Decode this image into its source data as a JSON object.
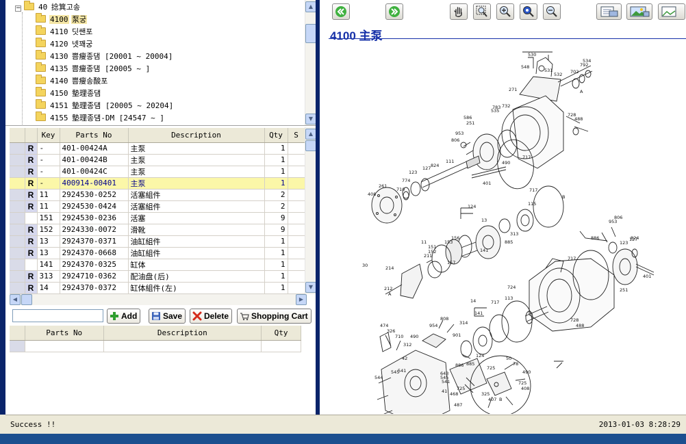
{
  "tree": {
    "root": {
      "code": "40",
      "label": "捻箕고송"
    },
    "items": [
      {
        "code": "4100",
        "label": "泵궁",
        "selected": true
      },
      {
        "code": "4110",
        "label": "딧쌘포"
      },
      {
        "code": "4120",
        "label": "넷꽤궁"
      },
      {
        "code": "4130",
        "label": "쁨瘦종댐  [20001 ~ 20004]"
      },
      {
        "code": "4135",
        "label": "쁨瘦종댐  [20005 ~ ]"
      },
      {
        "code": "4140",
        "label": "쁨瘦송酸포"
      },
      {
        "code": "4150",
        "label": "墊理종댐"
      },
      {
        "code": "4151",
        "label": "墊理종댐  [20005 ~ 20204]"
      },
      {
        "code": "4155",
        "label": "墊理종댐-DM  [24547  ~ ]"
      }
    ]
  },
  "parts_grid": {
    "columns": {
      "key": "Key",
      "parts_no": "Parts No",
      "description": "Description",
      "qty": "Qty",
      "s": "S"
    },
    "rows": [
      {
        "r": "R",
        "key": "-",
        "parts_no": "401-00424A",
        "description": "主泵",
        "qty": "1"
      },
      {
        "r": "R",
        "key": "-",
        "parts_no": "401-00424B",
        "description": "主泵",
        "qty": "1"
      },
      {
        "r": "R",
        "key": "-",
        "parts_no": "401-00424C",
        "description": "主泵",
        "qty": "1"
      },
      {
        "r": "R",
        "key": "-",
        "parts_no": "400914-00401",
        "description": "主泵",
        "qty": "1",
        "highlight": true
      },
      {
        "r": "R",
        "key": "11",
        "parts_no": "2924530-0252",
        "description": "活塞組件",
        "qty": "2"
      },
      {
        "r": "R",
        "key": "11",
        "parts_no": "2924530-0424",
        "description": "活塞組件",
        "qty": "2"
      },
      {
        "r": "",
        "key": "151",
        "parts_no": "2924530-0236",
        "description": "活塞",
        "qty": "9"
      },
      {
        "r": "R",
        "key": "152",
        "parts_no": "2924330-0072",
        "description": "滑靴",
        "qty": "9"
      },
      {
        "r": "R",
        "key": "13",
        "parts_no": "2924370-0371",
        "description": "油缸組件",
        "qty": "1"
      },
      {
        "r": "R",
        "key": "13",
        "parts_no": "2924370-0668",
        "description": "油缸組件",
        "qty": "1"
      },
      {
        "r": "",
        "key": "141",
        "parts_no": "2924370-0325",
        "description": "缸体",
        "qty": "1"
      },
      {
        "r": "R",
        "key": "313",
        "parts_no": "2924710-0362",
        "description": "配油盘(后)",
        "qty": "1"
      },
      {
        "r": "R",
        "key": "14",
        "parts_no": "2924370-0372",
        "description": "缸体組件(左)",
        "qty": "1"
      }
    ]
  },
  "actions": {
    "search_value": "",
    "add_label": "Add",
    "save_label": "Save",
    "delete_label": "Delete",
    "cart_label": "Shopping Cart"
  },
  "cart_grid": {
    "columns": {
      "parts_no": "Parts No",
      "description": "Description",
      "qty": "Qty"
    }
  },
  "diagram": {
    "title": "4100 主泵",
    "callouts": [
      "530",
      "548",
      "531",
      "534",
      "792",
      "702",
      "532",
      "271",
      "A",
      "783",
      "732",
      "586",
      "535",
      "728",
      "488",
      "251",
      "953",
      "806",
      "717",
      "490",
      "824",
      "127",
      "123",
      "111",
      "401",
      "774",
      "710",
      "261",
      "408",
      "717",
      "B",
      "115",
      "124",
      "13",
      "313",
      "141",
      "885",
      "157",
      "153",
      "156",
      "11",
      "151",
      "152",
      "211",
      "214",
      "212",
      "30",
      "A",
      "717",
      "724",
      "113",
      "14",
      "141",
      "314",
      "717",
      "728",
      "488",
      "251",
      "401",
      "127",
      "123",
      "886",
      "953",
      "806",
      "824",
      "474",
      "326",
      "710",
      "490",
      "808",
      "954",
      "901",
      "312",
      "42",
      "541",
      "545",
      "544",
      "886",
      "643",
      "545",
      "541",
      "725",
      "468",
      "487",
      "124",
      "885",
      "41",
      "50",
      "78",
      "490",
      "725",
      "725",
      "408",
      "325",
      "407",
      "B"
    ]
  },
  "status": {
    "message": "Success !!",
    "timestamp": "2013-01-03  8:28:29"
  },
  "colors": {
    "title_blue": "#1530a8",
    "highlight_row": "#fbf7a8",
    "frame_dark": "#0a246a"
  }
}
